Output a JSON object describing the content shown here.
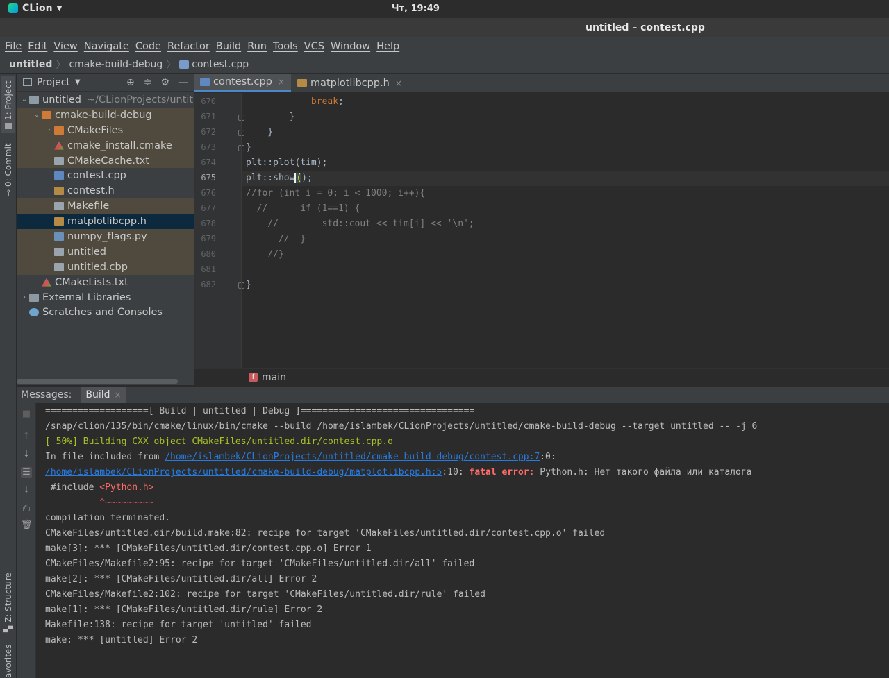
{
  "system": {
    "app_name": "CLion",
    "clock": "Чт, 19:49"
  },
  "window": {
    "title": "untitled – contest.cpp"
  },
  "menu": [
    "File",
    "Edit",
    "View",
    "Navigate",
    "Code",
    "Refactor",
    "Build",
    "Run",
    "Tools",
    "VCS",
    "Window",
    "Help"
  ],
  "breadcrumb": [
    "untitled",
    "cmake-build-debug",
    "contest.cpp"
  ],
  "left_strip": {
    "project_tab": "1: Project",
    "commit_tab": "0: Commit",
    "structure_tab": "Z: Structure",
    "favorites_tab": "avorites"
  },
  "project": {
    "title": "Project",
    "tree": [
      {
        "label": "untitled",
        "path": "~/CLionProjects/untit",
        "icon": "folder-icon"
      },
      {
        "label": "cmake-build-debug",
        "icon": "folder-icon"
      },
      {
        "label": "CMakeFiles",
        "icon": "folder-icon"
      },
      {
        "label": "cmake_install.cmake",
        "icon": "cmake-icon"
      },
      {
        "label": "CMakeCache.txt",
        "icon": "text-file-icon"
      },
      {
        "label": "contest.cpp",
        "icon": "cpp-file-icon"
      },
      {
        "label": "contest.h",
        "icon": "header-file-icon"
      },
      {
        "label": "Makefile",
        "icon": "text-file-icon"
      },
      {
        "label": "matplotlibcpp.h",
        "icon": "header-file-icon"
      },
      {
        "label": "numpy_flags.py",
        "icon": "python-file-icon"
      },
      {
        "label": "untitled",
        "icon": "executable-icon"
      },
      {
        "label": "untitled.cbp",
        "icon": "text-file-icon"
      },
      {
        "label": "CMakeLists.txt",
        "icon": "cmake-icon"
      },
      {
        "label": "External Libraries",
        "icon": "library-icon"
      },
      {
        "label": "Scratches and Consoles",
        "icon": "scratches-icon"
      }
    ]
  },
  "tabs": [
    {
      "label": "contest.cpp",
      "close": "×"
    },
    {
      "label": "matplotlibcpp.h",
      "close": "×"
    }
  ],
  "editor": {
    "lines": [
      {
        "n": "670",
        "t": "            break;"
      },
      {
        "n": "671",
        "t": "        }"
      },
      {
        "n": "672",
        "t": "    }"
      },
      {
        "n": "673",
        "t": "}"
      },
      {
        "n": "674",
        "t": "plt::plot(tim);"
      },
      {
        "n": "675",
        "a": "plt::show",
        "b": "(",
        "c": ");"
      },
      {
        "n": "676",
        "t": "//for (int i = 0; i < 1000; i++){"
      },
      {
        "n": "677",
        "t": "  //      if (1==1) {"
      },
      {
        "n": "678",
        "t": "    //        std::cout << tim[i] << '\\n';"
      },
      {
        "n": "679",
        "t": "      //  }"
      },
      {
        "n": "680",
        "t": "    //}"
      },
      {
        "n": "681",
        "t": ""
      },
      {
        "n": "682",
        "t": "}"
      }
    ],
    "kw_break": "break",
    "function_crumb": "main",
    "function_badge": "f"
  },
  "messages": {
    "label": "Messages:",
    "tab": "Build",
    "tab_close": "×",
    "output": {
      "l1": "===================[ Build | untitled | Debug ]================================",
      "l2": "/snap/clion/135/bin/cmake/linux/bin/cmake --build /home/islambek/CLionProjects/untitled/cmake-build-debug --target untitled -- -j 6",
      "l3": "[ 50%] Building CXX object CMakeFiles/untitled.dir/contest.cpp.o",
      "l4_prefix": "In file included from ",
      "l4_link": "/home/islambek/CLionProjects/untitled/cmake-build-debug/contest.cpp:7",
      "l4_suffix": ":0:",
      "l5_link": "/home/islambek/CLionProjects/untitled/cmake-build-debug/matplotlibcpp.h:5",
      "l5_mid": ":10: ",
      "l5_err": "fatal error:",
      "l5_suffix": " Python.h: Нет такого файла или каталога",
      "l6_prefix": " #include ",
      "l6_inc": "<Python.h>",
      "l7": "          ^~~~~~~~~~",
      "l8": "compilation terminated.",
      "l9": "CMakeFiles/untitled.dir/build.make:82: recipe for target 'CMakeFiles/untitled.dir/contest.cpp.o' failed",
      "l10": "make[3]: *** [CMakeFiles/untitled.dir/contest.cpp.o] Error 1",
      "l11": "CMakeFiles/Makefile2:95: recipe for target 'CMakeFiles/untitled.dir/all' failed",
      "l12": "make[2]: *** [CMakeFiles/untitled.dir/all] Error 2",
      "l13": "CMakeFiles/Makefile2:102: recipe for target 'CMakeFiles/untitled.dir/rule' failed",
      "l14": "make[1]: *** [CMakeFiles/untitled.dir/rule] Error 2",
      "l15": "Makefile:138: recipe for target 'untitled' failed",
      "l16": "make: *** [untitled] Error 2"
    }
  }
}
